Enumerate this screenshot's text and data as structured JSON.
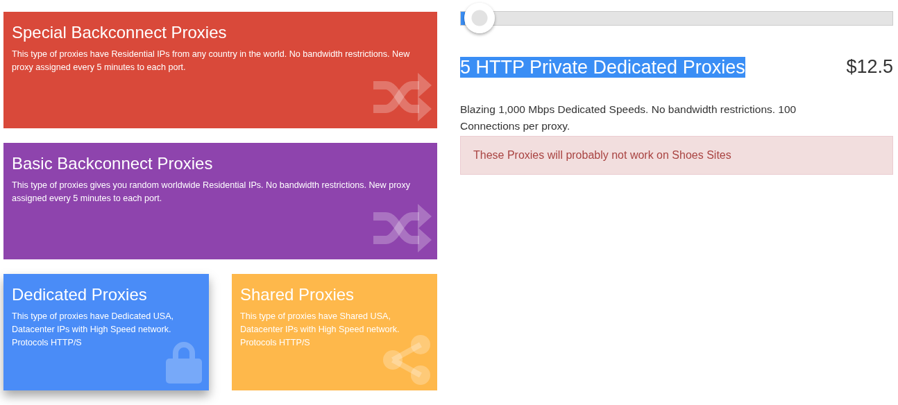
{
  "cards": [
    {
      "title": "Special Backconnect Proxies",
      "text": "This type of proxies have Residential IPs from any country in the world. No bandwidth restrictions. New proxy assigned every 5 minutes to each port.",
      "color": "#d9493a",
      "kind": "shuffle",
      "wide": true,
      "selected": false
    },
    {
      "title": "Basic Backconnect Proxies",
      "text": "This type of proxies gives you random worldwide Residential IPs. No bandwidth restrictions. New proxy assigned every 5 minutes to each port.",
      "color": "#8e44ad",
      "kind": "shuffle",
      "wide": true,
      "selected": false
    },
    {
      "title": "Dedicated Proxies",
      "text": "This type of proxies have Dedicated USA, Datacenter IPs with High Speed network. Protocols HTTP/S",
      "color": "#4a8cf7",
      "kind": "lock",
      "wide": false,
      "selected": true
    },
    {
      "title": "Shared Proxies",
      "text": "This type of proxies have Shared USA, Datacenter IPs with High Speed network. Protocols HTTP/S",
      "color": "#feb84b",
      "kind": "share",
      "wide": false,
      "selected": false
    }
  ],
  "slider": {
    "level": 0.01
  },
  "plan": {
    "title": "5 HTTP Private Dedicated Proxies",
    "highlighted": true,
    "price": "$12.5",
    "description": "Blazing 1,000 Mbps Dedicated Speeds. No bandwidth restrictions. 100 Connections per proxy.",
    "warning": "These Proxies will probably not work on Shoes Sites"
  }
}
